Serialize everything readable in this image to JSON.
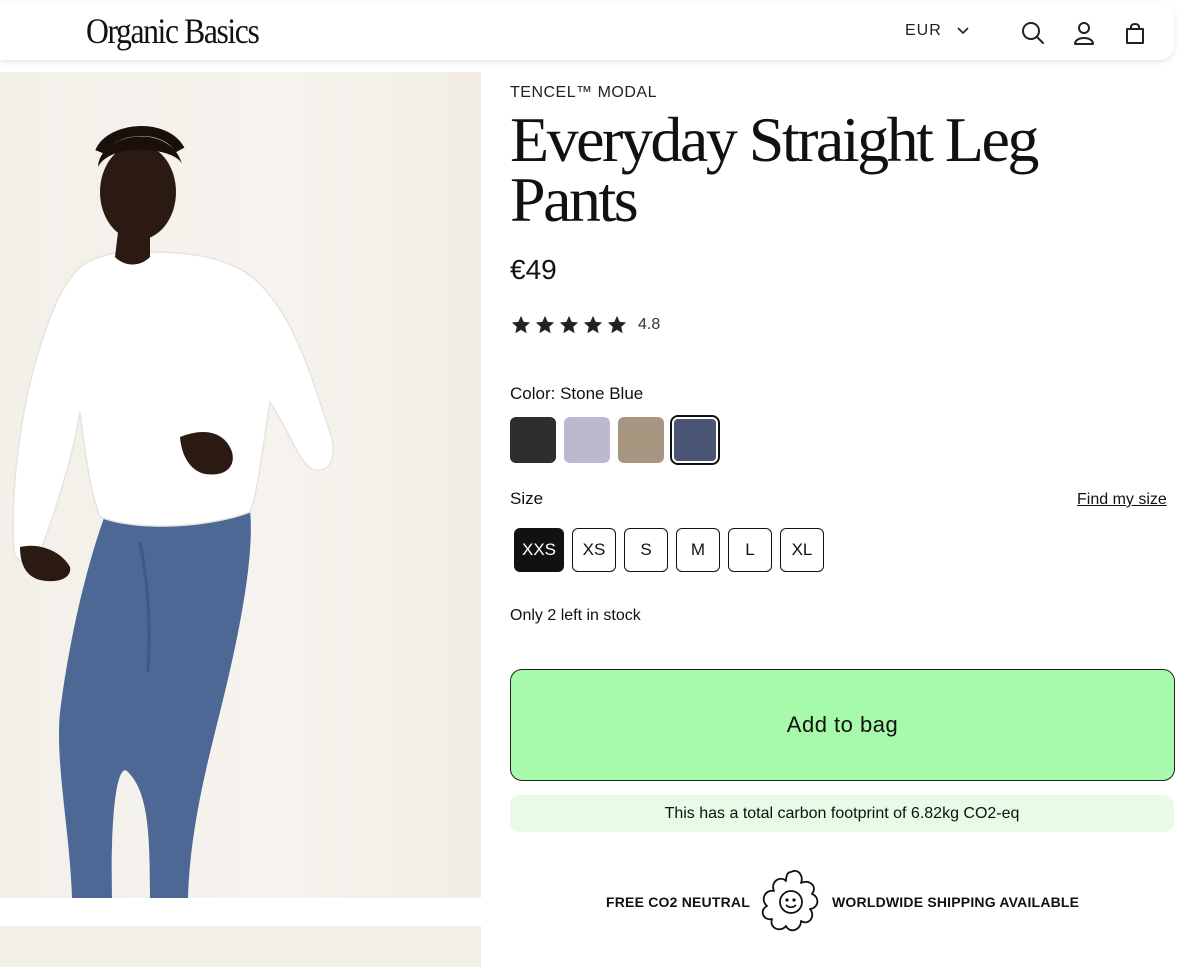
{
  "header": {
    "logo": "Organic Basics",
    "currency": "EUR",
    "icons": [
      "search-icon",
      "account-icon",
      "bag-icon"
    ]
  },
  "gallery": {
    "zoom_label": "+"
  },
  "product": {
    "eyebrow": "TENCEL™ MODAL",
    "title": "Everyday Straight Leg Pants",
    "price": "€49",
    "rating": "4.8",
    "stars_filled": 5,
    "color_label": "Color: Stone Blue",
    "swatches": [
      {
        "name": "black",
        "hex": "#2e2e30",
        "selected": false
      },
      {
        "name": "lavender",
        "hex": "#bdb8cf",
        "selected": false
      },
      {
        "name": "taupe",
        "hex": "#a89580",
        "selected": false
      },
      {
        "name": "stone-blue",
        "hex": "#4b5677",
        "selected": true
      }
    ],
    "size_label": "Size",
    "find_size": "Find my size",
    "sizes": [
      {
        "label": "XXS",
        "selected": true
      },
      {
        "label": "XS",
        "selected": false
      },
      {
        "label": "S",
        "selected": false
      },
      {
        "label": "M",
        "selected": false
      },
      {
        "label": "L",
        "selected": false
      },
      {
        "label": "XL",
        "selected": false
      }
    ],
    "stock_text": "Only 2 left in stock",
    "add_to_bag": "Add to bag",
    "carbon_text": "This has a total carbon footprint of 6.82kg CO2-eq",
    "shipping_left": "FREE CO2 NEUTRAL",
    "shipping_right": "WORLDWIDE SHIPPING AVAILABLE"
  },
  "colors": {
    "add_button": "#a7f9ab",
    "carbon_bg": "#e7fbe6",
    "selected_size": "#111111"
  }
}
